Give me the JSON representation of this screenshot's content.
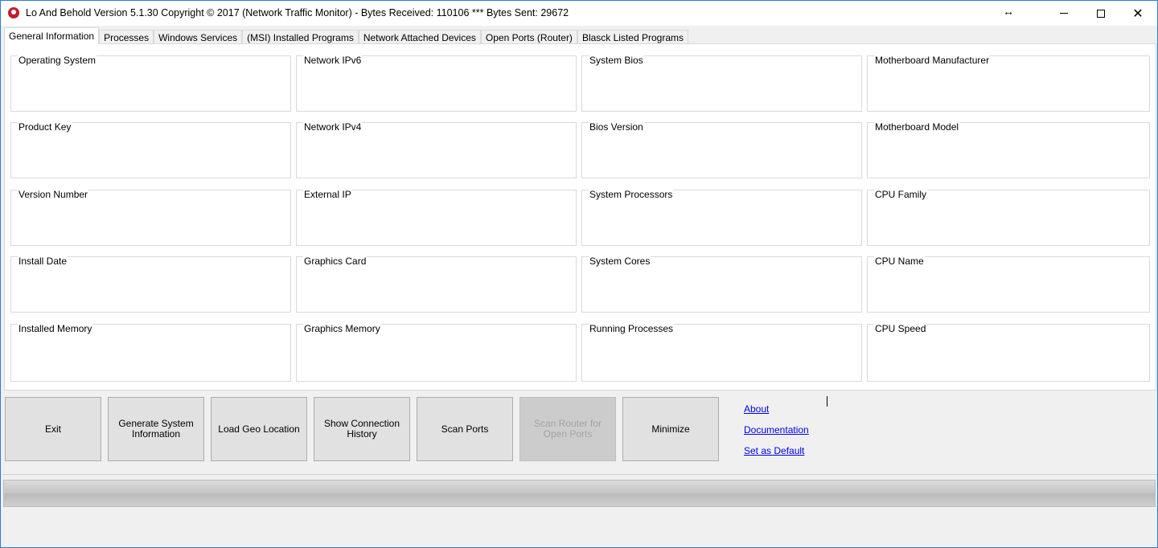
{
  "window": {
    "title": "Lo And Behold Version 5.1.30 Copyright ©  2017 (Network Traffic Monitor)  -   Bytes Received: 110106 *** Bytes Sent: 29672",
    "resize_glyph": "↔",
    "close_glyph": "✕"
  },
  "tabs": [
    {
      "label": "General Information",
      "active": true
    },
    {
      "label": "Processes"
    },
    {
      "label": "Windows Services"
    },
    {
      "label": "(MSI) Installed Programs"
    },
    {
      "label": "Network Attached Devices"
    },
    {
      "label": "Open Ports (Router)"
    },
    {
      "label": "Blasck Listed Programs"
    }
  ],
  "fields": {
    "col1": [
      "Operating System",
      "Product Key",
      "Version Number",
      "Install Date",
      "Installed Memory"
    ],
    "col2": [
      "Network IPv6",
      "Network IPv4",
      "External IP",
      "Graphics Card",
      "Graphics Memory"
    ],
    "col3": [
      "System Bios",
      "Bios Version",
      "System Processors",
      "System Cores",
      "Running Processes"
    ],
    "col4": [
      "Motherboard Manufacturer",
      "Motherboard Model",
      "CPU Family",
      "CPU Name",
      "CPU Speed"
    ]
  },
  "buttons": [
    {
      "label": "Exit"
    },
    {
      "label": "Generate System\nInformation"
    },
    {
      "label": "Load Geo Location"
    },
    {
      "label": "Show Connection\nHistory"
    },
    {
      "label": "Scan Ports"
    },
    {
      "label": "Scan Router for\nOpen Ports",
      "disabled": true
    },
    {
      "label": "Minimize"
    }
  ],
  "links": {
    "about": "About",
    "documentation": "Documentation",
    "set_default": "Set as Default"
  },
  "progress": {
    "value": 0
  },
  "colors": {
    "link": "#0000ee",
    "accent_border": "#2b7bd3",
    "progress_fill": "#06b025"
  }
}
